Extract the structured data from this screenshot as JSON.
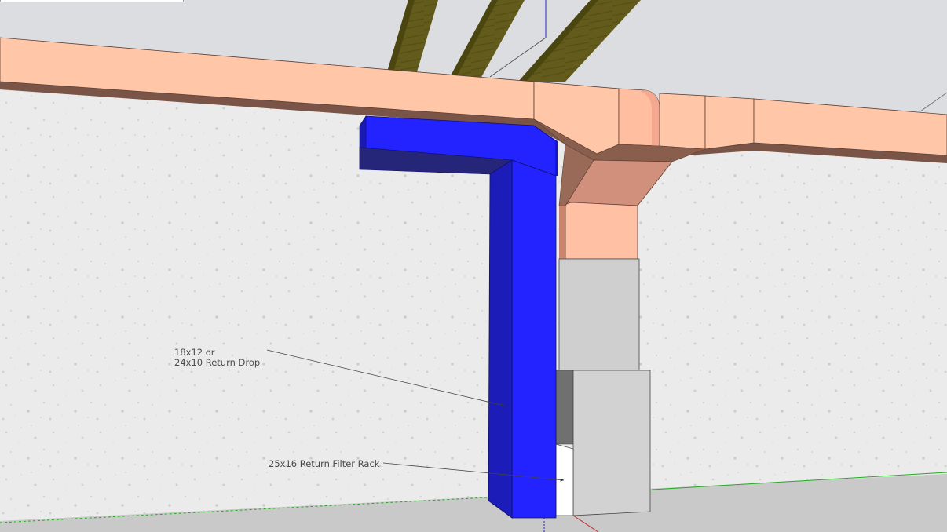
{
  "annotations": {
    "return_drop_line1": "18x12 or",
    "return_drop_line2": "24x10 Return Drop",
    "filter_rack": "25x16 Return Filter Rack"
  },
  "colors": {
    "return_duct": "#2a2aff",
    "supply_duct": "#ffc6a8",
    "wall": "#ececec",
    "floor": "#c8c8c8",
    "sky": "#dcdde0",
    "joist": "#5e5818",
    "equipment": "#cfcfcf",
    "axis_green": "#22aa22",
    "axis_red": "#cc2222",
    "axis_blue": "#2222cc"
  }
}
